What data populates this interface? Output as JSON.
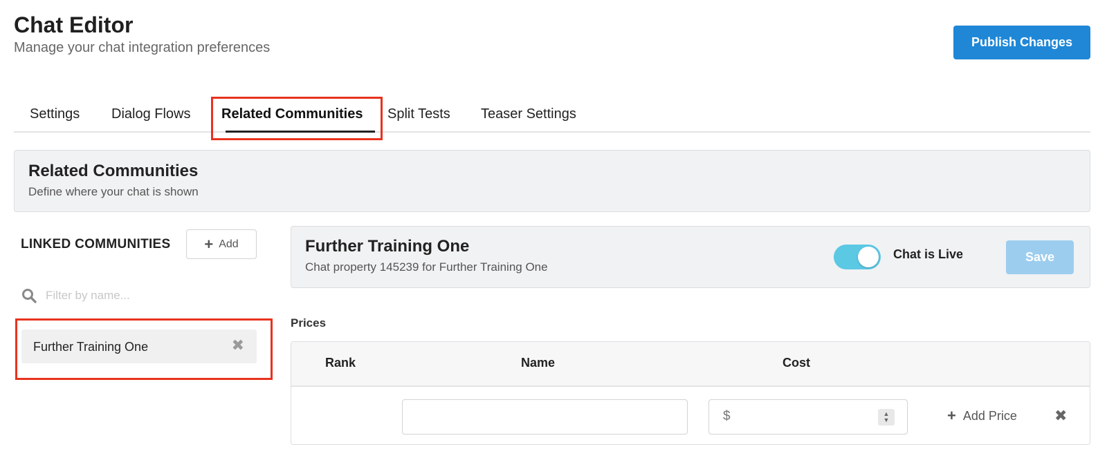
{
  "header": {
    "title": "Chat Editor",
    "subtitle": "Manage your chat integration preferences",
    "publish_label": "Publish Changes"
  },
  "tabs": [
    {
      "label": "Settings",
      "active": false
    },
    {
      "label": "Dialog Flows",
      "active": false
    },
    {
      "label": "Related Communities",
      "active": true
    },
    {
      "label": "Split Tests",
      "active": false
    },
    {
      "label": "Teaser Settings",
      "active": false
    }
  ],
  "section": {
    "title": "Related Communities",
    "subtitle": "Define where your chat is shown"
  },
  "sidebar": {
    "heading": "LINKED COMMUNITIES",
    "add_label": "Add",
    "search_placeholder": "Filter by name...",
    "items": [
      {
        "name": "Further Training One"
      }
    ]
  },
  "detail": {
    "title": "Further Training One",
    "subtitle": "Chat property 145239 for Further Training One",
    "chat_live": true,
    "live_label": "Chat is Live",
    "save_label": "Save"
  },
  "prices": {
    "label": "Prices",
    "columns": [
      "Rank",
      "Name",
      "Cost"
    ],
    "currency_symbol": "$",
    "name_value": "",
    "cost_value": "",
    "add_price_label": "Add Price"
  },
  "colors": {
    "accent": "#1f87d6",
    "toggle_on": "#5bc8e4",
    "save_disabled": "#9ccdef",
    "highlight": "#e8321e"
  },
  "icons": {
    "search": "search-icon",
    "plus": "plus-icon",
    "remove": "close-icon",
    "stepper": "stepper-icon"
  }
}
